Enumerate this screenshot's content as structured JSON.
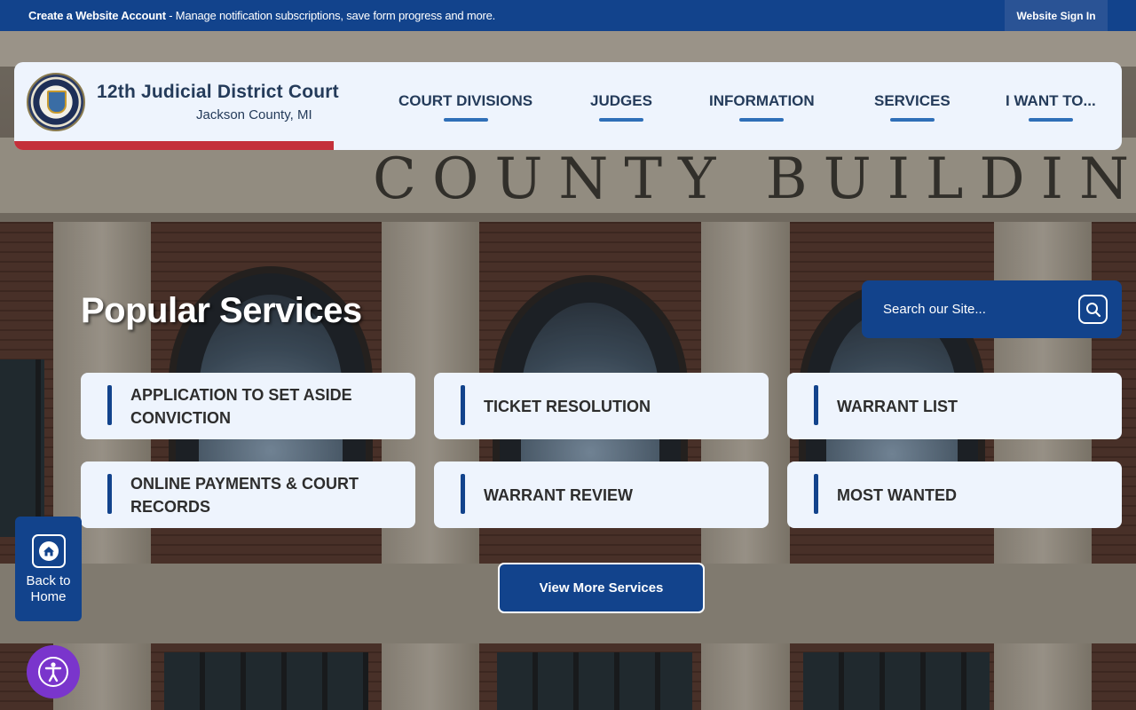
{
  "topbar": {
    "promo_bold": "Create a Website Account",
    "promo_rest": " - Manage notification subscriptions, save form progress and more.",
    "signin_label": "Website Sign In"
  },
  "header": {
    "title": "12th Judicial District Court",
    "subtitle": "Jackson County, MI",
    "nav": [
      "COURT DIVISIONS",
      "JUDGES",
      "INFORMATION",
      "SERVICES",
      "I WANT TO..."
    ]
  },
  "background": {
    "engraving": "COUNTY BUILDING"
  },
  "search": {
    "placeholder": "Search our Site..."
  },
  "services": {
    "heading": "Popular Services",
    "items": [
      "APPLICATION TO SET ASIDE CONVICTION",
      "TICKET RESOLUTION",
      "WARRANT LIST",
      "ONLINE PAYMENTS & COURT RECORDS",
      "WARRANT REVIEW",
      "MOST WANTED"
    ],
    "more_label": "View More Services"
  },
  "back_to_home": {
    "line1": "Back to",
    "line2": "Home"
  },
  "icons": {
    "search": "search-icon",
    "home": "home-icon",
    "accessibility": "accessibility-icon",
    "seal": "state-seal-logo"
  },
  "colors": {
    "primary_blue": "#12438c",
    "accent_red": "#c4303a",
    "nav_underline": "#2f6fb8",
    "card_bg": "#eef4fd",
    "accessibility_purple": "#7a35cc"
  }
}
